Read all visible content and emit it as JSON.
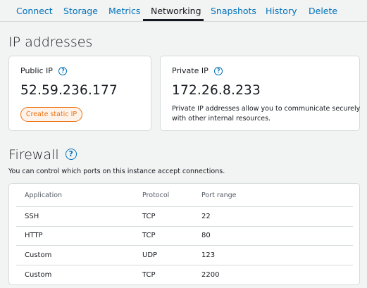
{
  "tabs": [
    {
      "label": "Connect",
      "active": false
    },
    {
      "label": "Storage",
      "active": false
    },
    {
      "label": "Metrics",
      "active": false
    },
    {
      "label": "Networking",
      "active": true
    },
    {
      "label": "Snapshots",
      "active": false
    },
    {
      "label": "History",
      "active": false
    },
    {
      "label": "Delete",
      "active": false
    }
  ],
  "ip_section": {
    "title": "IP addresses",
    "public": {
      "label": "Public IP",
      "value": "52.59.236.177",
      "button_label": "Create static IP"
    },
    "private": {
      "label": "Private IP",
      "value": "172.26.8.233",
      "description": "Private IP addresses allow you to communicate securely with other internal resources."
    }
  },
  "firewall": {
    "title": "Firewall",
    "description": "You can control which ports on this instance accept connections.",
    "columns": [
      "Application",
      "Protocol",
      "Port range"
    ],
    "rows": [
      [
        "SSH",
        "TCP",
        "22"
      ],
      [
        "HTTP",
        "TCP",
        "80"
      ],
      [
        "Custom",
        "UDP",
        "123"
      ],
      [
        "Custom",
        "TCP",
        "2200"
      ]
    ]
  },
  "icons": {
    "help": "?"
  },
  "colors": {
    "link": "#0073bb",
    "accent": "#ec7211",
    "text": "#16191f",
    "background": "#f2f3f3"
  }
}
